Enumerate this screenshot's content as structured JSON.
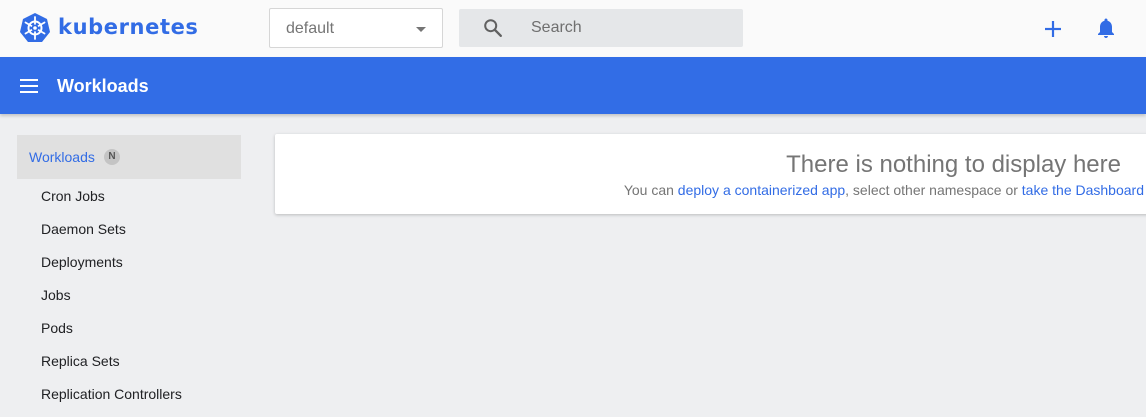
{
  "topbar": {
    "brand": "kubernetes",
    "namespace_value": "default",
    "search_placeholder": "Search"
  },
  "titlebar": {
    "title": "Workloads"
  },
  "sidebar": {
    "section_label": "Workloads",
    "namespace_badge": "N",
    "items": [
      {
        "label": "Cron Jobs"
      },
      {
        "label": "Daemon Sets"
      },
      {
        "label": "Deployments"
      },
      {
        "label": "Jobs"
      },
      {
        "label": "Pods"
      },
      {
        "label": "Replica Sets"
      },
      {
        "label": "Replication Controllers"
      }
    ]
  },
  "empty_state": {
    "title": "There is nothing to display here",
    "text_prefix": "You can ",
    "link_deploy": "deploy a containerized app",
    "text_middle": ", select other namespace or ",
    "link_tour": "take the Dashboard"
  },
  "colors": {
    "accent": "#326ce5",
    "background": "#eeeff1"
  },
  "icons": [
    "kubernetes-logo-icon",
    "chevron-down-icon",
    "search-icon",
    "plus-icon",
    "bell-icon",
    "menu-icon"
  ]
}
